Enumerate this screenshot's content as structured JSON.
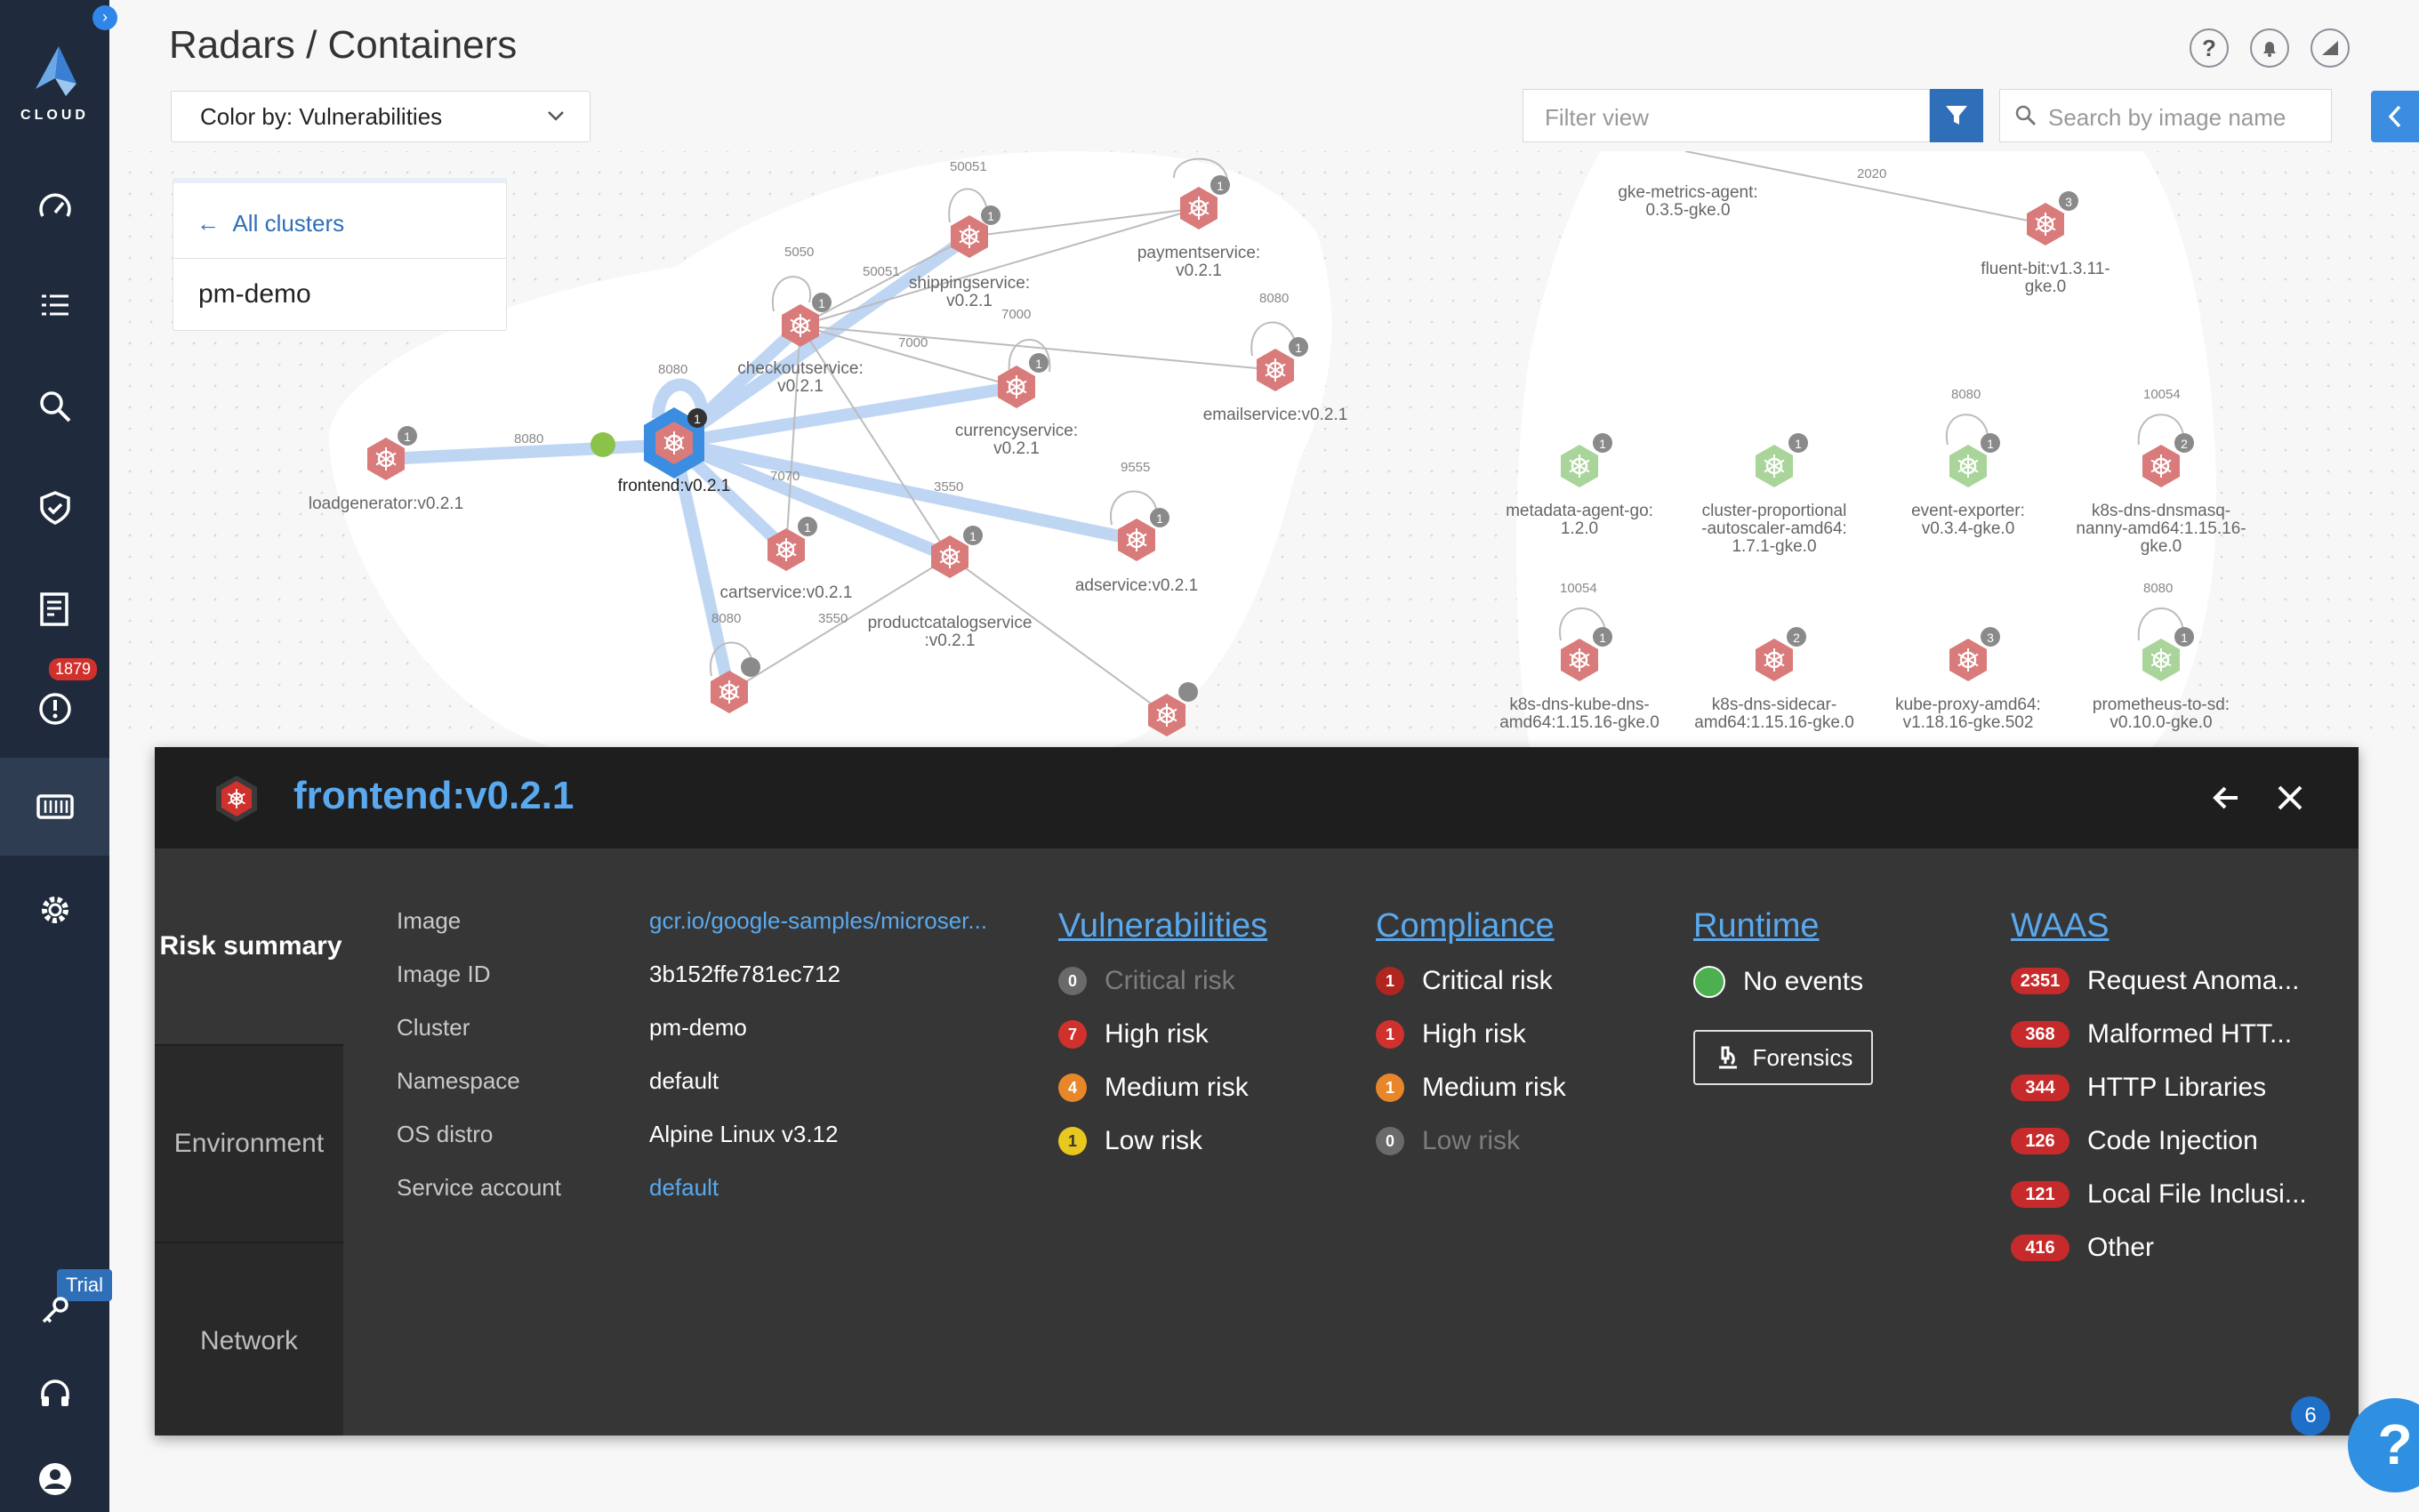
{
  "sidebar": {
    "logo_text": "CLOUD",
    "alerts_badge": "1879",
    "trial_label": "Trial"
  },
  "header": {
    "title": "Radars / Containers",
    "color_by": "Color by: Vulnerabilities",
    "filter_placeholder": "Filter view",
    "search_placeholder": "Search by image name"
  },
  "cluster_card": {
    "back_label": "All clusters",
    "cluster_name": "pm-demo"
  },
  "graph": {
    "nodes": [
      {
        "name": "loadgenerator:v0.2.1",
        "count": "1"
      },
      {
        "name": "frontend:v0.2.1",
        "count": "1"
      },
      {
        "name": "checkoutservice:\nv0.2.1",
        "count": "1"
      },
      {
        "name": "shippingservice:\nv0.2.1",
        "count": "1"
      },
      {
        "name": "paymentservice:\nv0.2.1",
        "count": "1"
      },
      {
        "name": "currencyservice:\nv0.2.1",
        "count": "1"
      },
      {
        "name": "emailservice:v0.2.1",
        "count": "1"
      },
      {
        "name": "adservice:v0.2.1",
        "count": "1"
      },
      {
        "name": "cartservice:v0.2.1",
        "count": "1"
      },
      {
        "name": "productcatalogservice\n:v0.2.1",
        "count": "1"
      },
      {
        "name": "gke-metrics-agent:\n0.3.5-gke.0",
        "count": ""
      },
      {
        "name": "fluent-bit:v1.3.11-\ngke.0",
        "count": "3"
      },
      {
        "name": "metadata-agent-go:\n1.2.0",
        "count": "1"
      },
      {
        "name": "cluster-proportional\n-autoscaler-amd64:\n1.7.1-gke.0",
        "count": "1"
      },
      {
        "name": "event-exporter:\nv0.3.4-gke.0",
        "count": "1"
      },
      {
        "name": "k8s-dns-dnsmasq-\nnanny-amd64:1.15.16-\ngke.0",
        "count": "2"
      },
      {
        "name": "k8s-dns-kube-dns-\namd64:1.15.16-gke.0",
        "count": "1"
      },
      {
        "name": "k8s-dns-sidecar-\namd64:1.15.16-gke.0",
        "count": "2"
      },
      {
        "name": "kube-proxy-amd64:\nv1.18.16-gke.502",
        "count": "3"
      },
      {
        "name": "prometheus-to-sd:\nv0.10.0-gke.0",
        "count": "1"
      }
    ],
    "ports": [
      "8080",
      "5050",
      "50051",
      "7000",
      "3550",
      "9555",
      "7070",
      "2020",
      "10054"
    ]
  },
  "panel": {
    "title": "frontend:v0.2.1",
    "tabs": [
      "Risk summary",
      "Environment",
      "Network"
    ],
    "details": [
      {
        "label": "Image",
        "value": "gcr.io/google-samples/microser..."
      },
      {
        "label": "Image ID",
        "value": "3b152ffe781ec712"
      },
      {
        "label": "Cluster",
        "value": "pm-demo"
      },
      {
        "label": "Namespace",
        "value": "default"
      },
      {
        "label": "OS distro",
        "value": "Alpine Linux v3.12"
      },
      {
        "label": "Service account",
        "value": "default"
      }
    ],
    "vulnerabilities": {
      "heading": "Vulnerabilities",
      "items": [
        {
          "count": "0",
          "label": "Critical risk",
          "color": "#6a6a6a"
        },
        {
          "count": "7",
          "label": "High risk",
          "color": "#d0312d"
        },
        {
          "count": "4",
          "label": "Medium risk",
          "color": "#e8862a"
        },
        {
          "count": "1",
          "label": "Low risk",
          "color": "#e8c81e"
        }
      ]
    },
    "compliance": {
      "heading": "Compliance",
      "items": [
        {
          "count": "1",
          "label": "Critical risk",
          "color": "#b0251f"
        },
        {
          "count": "1",
          "label": "High risk",
          "color": "#d0312d"
        },
        {
          "count": "1",
          "label": "Medium risk",
          "color": "#e8862a"
        },
        {
          "count": "0",
          "label": "Low risk",
          "color": "#6a6a6a"
        }
      ]
    },
    "runtime": {
      "heading": "Runtime",
      "status": "No events",
      "forensics_label": "Forensics"
    },
    "waas": {
      "heading": "WAAS",
      "items": [
        {
          "count": "2351",
          "label": "Request Anoma..."
        },
        {
          "count": "368",
          "label": "Malformed HTT..."
        },
        {
          "count": "344",
          "label": "HTTP Libraries"
        },
        {
          "count": "126",
          "label": "Code Injection"
        },
        {
          "count": "121",
          "label": "Local File Inclusi..."
        },
        {
          "count": "416",
          "label": "Other"
        }
      ]
    }
  },
  "help": {
    "badge": "6",
    "label": "?"
  },
  "colors": {
    "accent": "#2f6fb8",
    "link": "#5aa9ee",
    "sidebar": "#1f2b3c",
    "panel": "#363636"
  }
}
